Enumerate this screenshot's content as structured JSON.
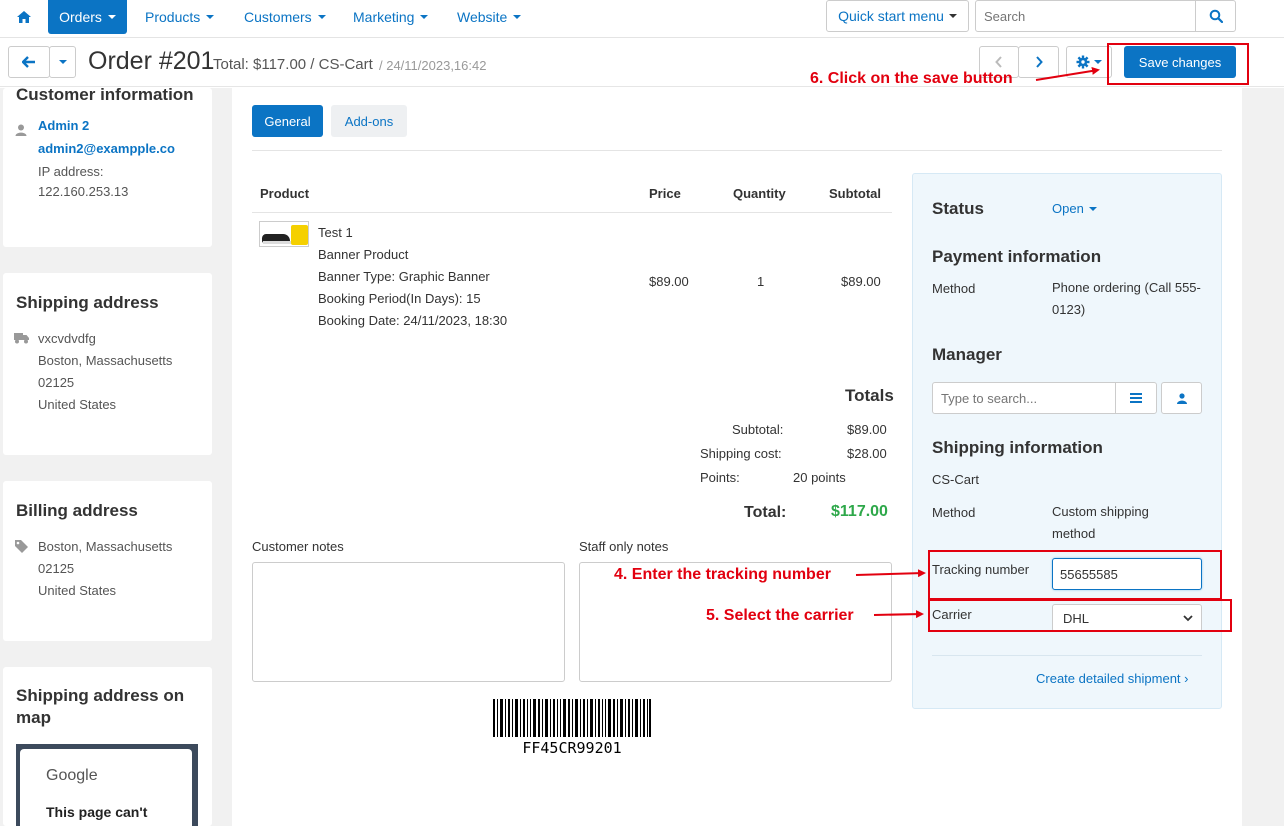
{
  "nav": {
    "items": [
      {
        "label": "Orders",
        "active": true
      },
      {
        "label": "Products"
      },
      {
        "label": "Customers"
      },
      {
        "label": "Marketing"
      },
      {
        "label": "Website"
      }
    ],
    "quick_start": "Quick start menu",
    "search_placeholder": "Search"
  },
  "header": {
    "title": "Order #201",
    "summary": "Total: $117.00 / CS-Cart",
    "date": "/ 24/11/2023,16:42",
    "save_label": "Save changes"
  },
  "sidebar": {
    "customer": {
      "title": "Customer information",
      "name": "Admin 2",
      "email": "admin2@exampple.co",
      "ip_label": "IP address:",
      "ip": "122.160.253.13"
    },
    "shipping": {
      "title": "Shipping address",
      "lines": [
        "vxcvdvdfg",
        "Boston, Massachusetts",
        "02125",
        "United States"
      ]
    },
    "billing": {
      "title": "Billing address",
      "lines": [
        "Boston, Massachusetts",
        "02125",
        "United States"
      ]
    },
    "map": {
      "title": "Shipping address on map",
      "google": "Google",
      "message": "This page can't"
    }
  },
  "tabs": [
    {
      "label": "General",
      "active": true
    },
    {
      "label": "Add-ons"
    }
  ],
  "products": {
    "headers": [
      "Product",
      "Price",
      "Quantity",
      "Subtotal"
    ],
    "rows": [
      {
        "name": "Test 1",
        "details": [
          "Banner Product",
          "Banner Type: Graphic Banner",
          "Booking Period(In Days): 15",
          "Booking Date: 24/11/2023, 18:30"
        ],
        "price": "$89.00",
        "quantity": "1",
        "subtotal": "$89.00"
      }
    ]
  },
  "totals": {
    "title": "Totals",
    "subtotal_label": "Subtotal:",
    "subtotal": "$89.00",
    "shipping_label": "Shipping cost:",
    "shipping": "$28.00",
    "points_label": "Points:",
    "points": "20 points",
    "total_label": "Total:",
    "total": "$117.00"
  },
  "notes": {
    "customer_label": "Customer notes",
    "staff_label": "Staff only notes"
  },
  "barcode": "FF45CR99201",
  "panel": {
    "status_label": "Status",
    "status_value": "Open",
    "payment_title": "Payment information",
    "method_label": "Method",
    "payment_method": "Phone ordering (Call 555-0123)",
    "manager_title": "Manager",
    "manager_placeholder": "Type to search...",
    "shipping_title": "Shipping information",
    "shipping_vendor": "CS-Cart",
    "shipping_method_label": "Method",
    "shipping_method": "Custom shipping method",
    "tracking_label": "Tracking number",
    "tracking_value": "55655585",
    "carrier_label": "Carrier",
    "carrier_value": "DHL",
    "create_shipment": "Create detailed shipment ›"
  },
  "annotations": {
    "step4": "4. Enter the tracking number",
    "step5": "5. Select the carrier",
    "step6": "6. Click on the save button"
  },
  "colors": {
    "accent": "#0b74c4",
    "total_green": "#2ea84a",
    "annotation_red": "#e2000f",
    "panel_bg": "#eff7fc"
  }
}
